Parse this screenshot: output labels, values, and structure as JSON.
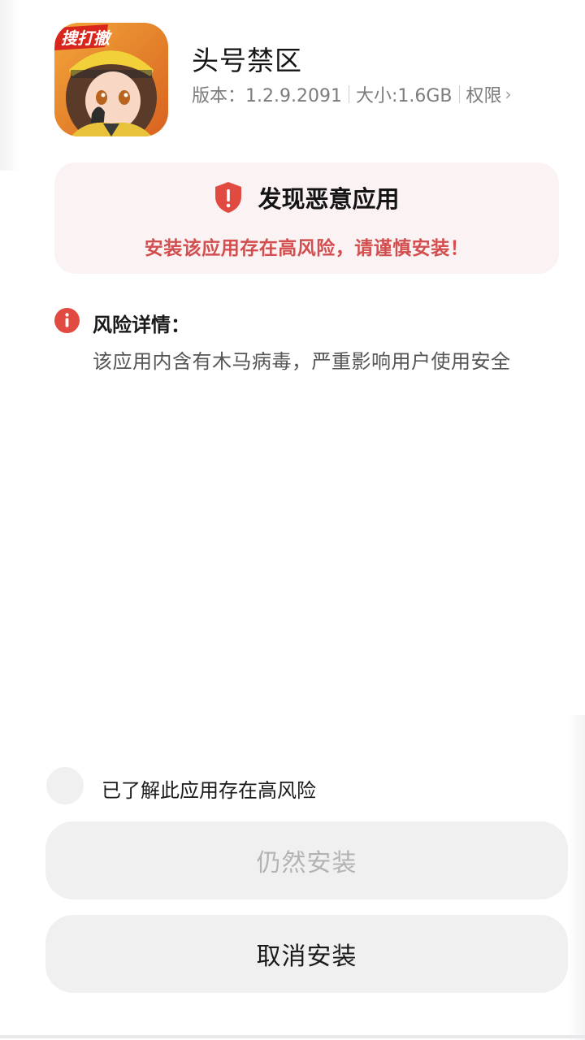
{
  "app": {
    "icon_name": "game-app-icon",
    "icon_text": "搜打撤",
    "name": "头号禁区",
    "version_label": "版本：1.2.9.2091",
    "size_label": "大小:1.6GB",
    "permissions_label": "权限"
  },
  "warning": {
    "icon_name": "shield-alert-icon",
    "title": "发现恶意应用",
    "subtitle": "安装该应用存在高风险，请谨慎安装！",
    "accent_color": "#d34e4e",
    "card_bg": "#fbf3f3"
  },
  "risk": {
    "icon_name": "info-alert-icon",
    "heading": "风险详情：",
    "description": "该应用内含有木马病毒，严重影响用户使用安全"
  },
  "acknowledge": {
    "checked": false,
    "label": "已了解此应用存在高风险"
  },
  "buttons": {
    "install_anyway": "仍然安装",
    "install_anyway_enabled": false,
    "cancel_install": "取消安装"
  }
}
